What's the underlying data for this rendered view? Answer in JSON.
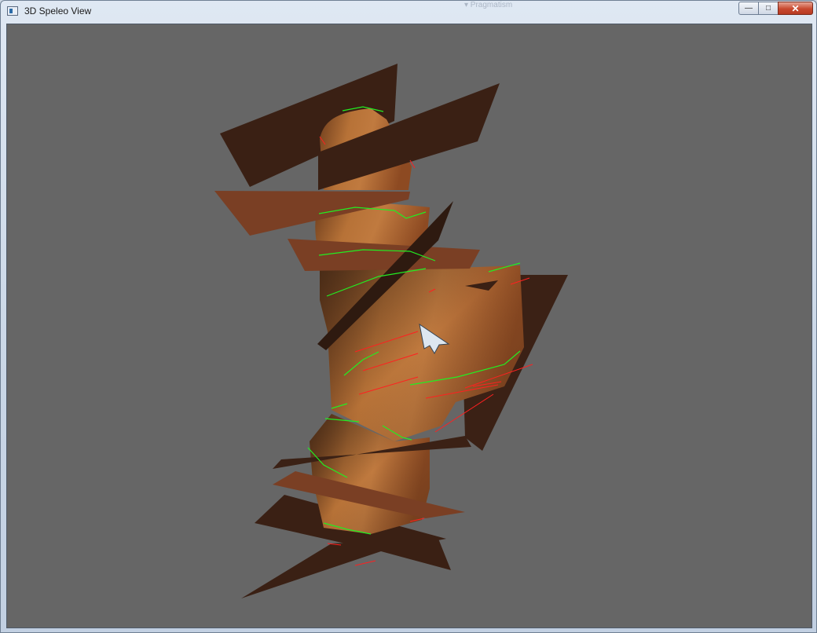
{
  "window": {
    "title": "3D Speleo View",
    "ghost_text": "▾ Pragmatism",
    "buttons": {
      "minimize": "—",
      "maximize": "□",
      "close": "✕"
    }
  },
  "viewport": {
    "background": "#666666",
    "cave_color": "#a5612f",
    "plane_dark": "#3a2014",
    "plane_light": "#7a3f24",
    "survey_line_color": "#22ee22",
    "splay_color": "#ff2020"
  },
  "icons": [
    "app-icon",
    "cursor-arrow-icon"
  ]
}
